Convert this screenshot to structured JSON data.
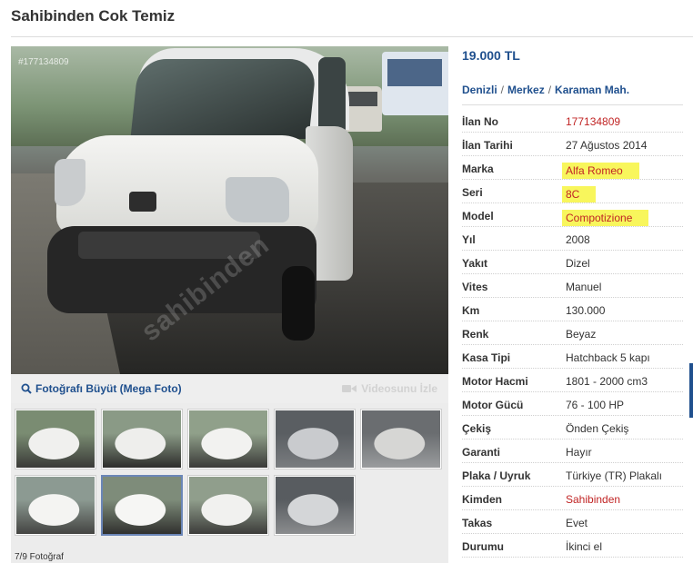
{
  "listing": {
    "title": "Sahibinden Cok Temiz",
    "photo_id": "#177134809",
    "watermark": "sahibinden"
  },
  "gallery": {
    "enlarge_label": "Fotoğrafı Büyüt (Mega Foto)",
    "video_label": "Videosunu İzle",
    "counter": "7/9 Fotoğraf",
    "active_index": 6
  },
  "summary": {
    "price": "19.000 TL",
    "location": [
      "Denizli",
      "Merkez",
      "Karaman Mah."
    ]
  },
  "details": [
    {
      "key": "İlan No",
      "value": "177134809",
      "style": "red"
    },
    {
      "key": "İlan Tarihi",
      "value": "27 Ağustos 2014",
      "style": ""
    },
    {
      "key": "Marka",
      "value": "Alfa Romeo",
      "style": "hl"
    },
    {
      "key": "Seri",
      "value": "8C",
      "style": "hl"
    },
    {
      "key": "Model",
      "value": "Compotizione",
      "style": "hl"
    },
    {
      "key": "Yıl",
      "value": "2008",
      "style": ""
    },
    {
      "key": "Yakıt",
      "value": "Dizel",
      "style": ""
    },
    {
      "key": "Vites",
      "value": "Manuel",
      "style": ""
    },
    {
      "key": "Km",
      "value": "130.000",
      "style": ""
    },
    {
      "key": "Renk",
      "value": "Beyaz",
      "style": ""
    },
    {
      "key": "Kasa Tipi",
      "value": "Hatchback 5 kapı",
      "style": ""
    },
    {
      "key": "Motor Hacmi",
      "value": "1801 - 2000 cm3",
      "style": ""
    },
    {
      "key": "Motor Gücü",
      "value": "76 - 100 HP",
      "style": ""
    },
    {
      "key": "Çekiş",
      "value": "Önden Çekiş",
      "style": ""
    },
    {
      "key": "Garanti",
      "value": "Hayır",
      "style": ""
    },
    {
      "key": "Plaka / Uyruk",
      "value": "Türkiye (TR) Plakalı",
      "style": ""
    },
    {
      "key": "Kimden",
      "value": "Sahibinden",
      "style": "red"
    },
    {
      "key": "Takas",
      "value": "Evet",
      "style": ""
    },
    {
      "key": "Durumu",
      "value": "İkinci el",
      "style": ""
    }
  ],
  "colors": {
    "link": "#20508e",
    "red": "#c12525",
    "highlight": "#f8f65c"
  }
}
